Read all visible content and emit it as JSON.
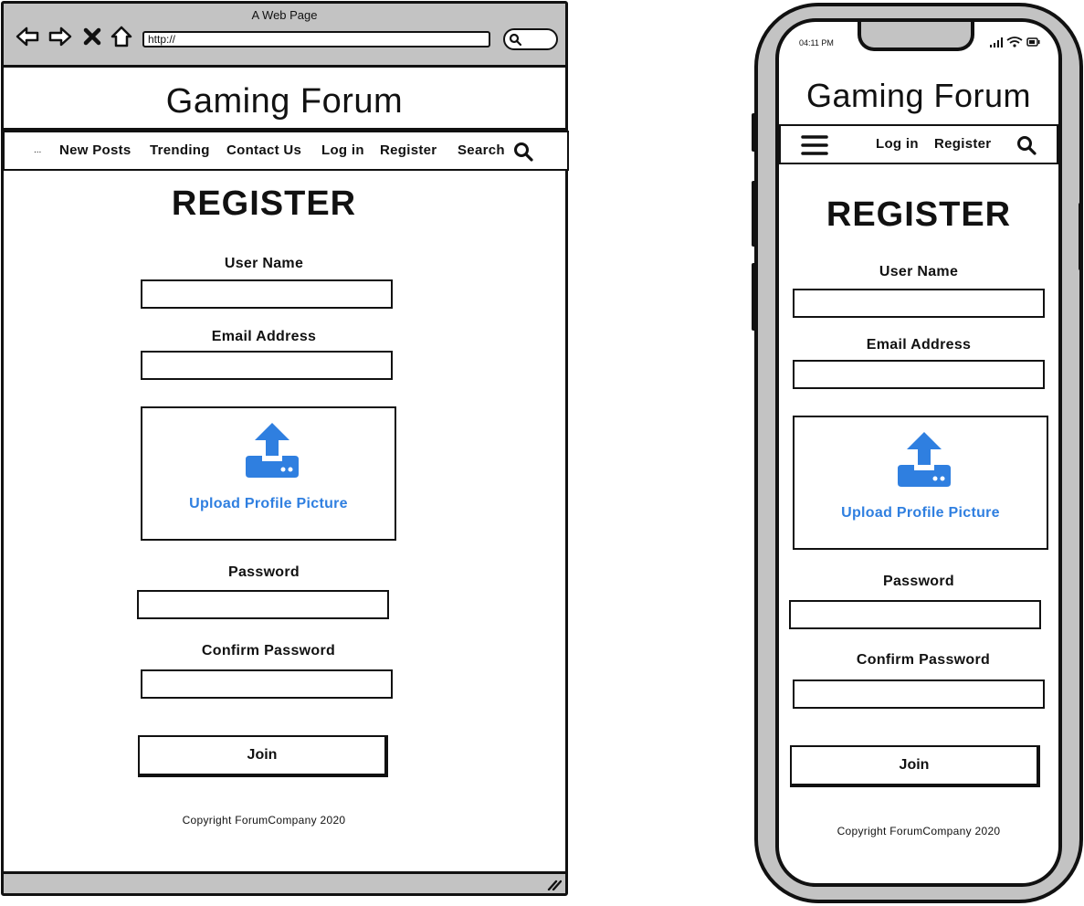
{
  "desktop": {
    "window_title": "A Web Page",
    "url": "http://",
    "site_title": "Gaming Forum",
    "nav": {
      "more": "...",
      "items": [
        "New Posts",
        "Trending",
        "Contact Us",
        "Log in",
        "Register",
        "Search"
      ]
    }
  },
  "mobile": {
    "status_time": "04:11 PM",
    "site_title": "Gaming Forum",
    "nav": {
      "items": [
        "Log in",
        "Register"
      ]
    }
  },
  "form": {
    "title": "REGISTER",
    "username_label": "User Name",
    "email_label": "Email Address",
    "upload_label": "Upload Profile Picture",
    "password_label": "Password",
    "confirm_label": "Confirm Password",
    "join_label": "Join"
  },
  "footer": {
    "copyright": "Copyright ForumCompany 2020"
  },
  "colors": {
    "accent": "#2f7fe0",
    "chrome": "#c3c3c3",
    "ink": "#111111"
  }
}
